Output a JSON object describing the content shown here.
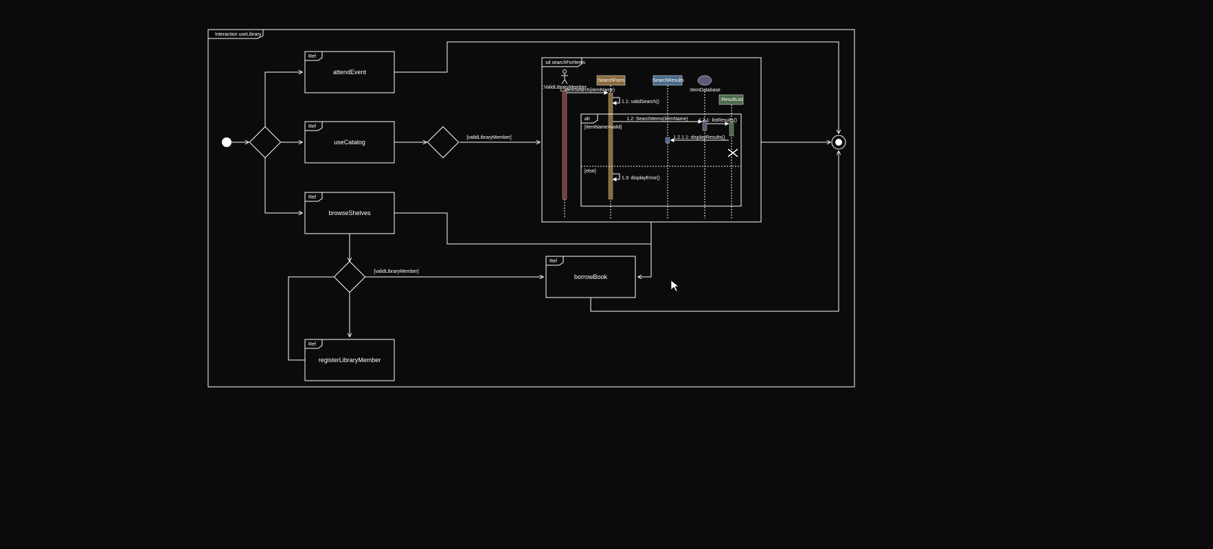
{
  "outer": {
    "title": "Interaction useLibrary"
  },
  "refs": {
    "attendEvent": {
      "tag": "Ref",
      "name": "attendEvent"
    },
    "useCatalog": {
      "tag": "Ref",
      "name": "useCatalog"
    },
    "browseShelves": {
      "tag": "Ref",
      "name": "browseShelves"
    },
    "registerLibraryMember": {
      "tag": "Ref",
      "name": "registerLibraryMember"
    },
    "borrowBook": {
      "tag": "Ref",
      "name": "borrowBook"
    }
  },
  "guards": {
    "validLibraryMember1": "[validLibraryMember]",
    "validLibraryMember2": "[validLibraryMember]"
  },
  "sd": {
    "title": "sd searchForItems",
    "lifelines": {
      "l1": ":ValidLibraryMember",
      "l2": ":SearchForm",
      "l3": ":SearchResults",
      "l4": ":ItemDatabase",
      "l5": ":ResultList"
    },
    "messages": {
      "m1": "1: ItemSearch(itemName)",
      "m11": "1.1: validSearch()",
      "m12": "1.2: SearchItems(itemName)",
      "m121": "1.2.1: listResults()",
      "m1211": "1.2.1.1: displayResults()",
      "m13": "1.3: displayError()"
    },
    "alt": {
      "label": "alt",
      "cond1": "[itemName=valid]",
      "cond2": "[else]"
    }
  },
  "colors": {
    "bgDark": "#0b0b0b",
    "actor": "#e8e8e8",
    "searchForm": "#8a6a3a",
    "searchResults": "#4a6a8a",
    "itemDatabase": "#5a5a7a",
    "resultList": "#4a6a4a"
  }
}
